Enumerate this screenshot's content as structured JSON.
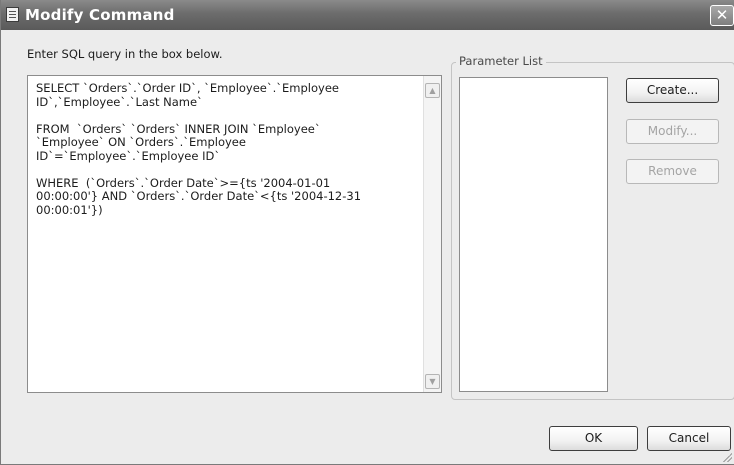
{
  "window": {
    "title": "Modify Command",
    "close_glyph": "✕",
    "icon": "document-icon"
  },
  "query": {
    "prompt": "Enter SQL query in the box below.",
    "sql_text": "SELECT `Orders`.`Order ID`, `Employee`.`Employee\nID`,`Employee`.`Last Name`\n\nFROM  `Orders` `Orders` INNER JOIN `Employee`\n`Employee` ON `Orders`.`Employee\nID`=`Employee`.`Employee ID`\n\nWHERE  (`Orders`.`Order Date`>={ts '2004-01-01\n00:00:00'} AND `Orders`.`Order Date`<{ts '2004-12-31\n00:00:01'})",
    "scroll_up_glyph": "▲",
    "scroll_down_glyph": "▼"
  },
  "parameters": {
    "group_label": "Parameter List",
    "items": [],
    "create_label": "Create...",
    "modify_label": "Modify...",
    "remove_label": "Remove"
  },
  "footer": {
    "ok_label": "OK",
    "cancel_label": "Cancel"
  },
  "colors": {
    "titlebar": "#6c6c6c",
    "dialog_background": "#ececec",
    "disabled_text": "#a4a4a4"
  }
}
